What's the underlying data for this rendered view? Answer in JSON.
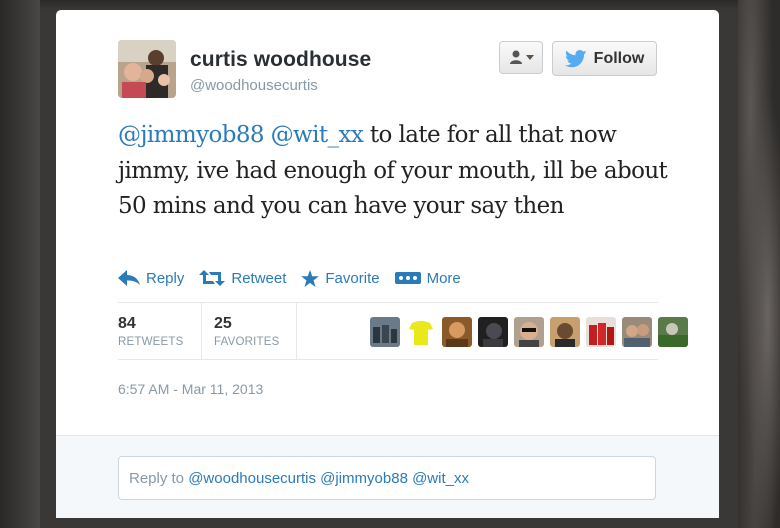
{
  "user": {
    "name": "curtis woodhouse",
    "handle": "@woodhousecurtis"
  },
  "buttons": {
    "follow_label": "Follow"
  },
  "tweet": {
    "mention1": "@jimmyob88",
    "mention2": "@wit_xx",
    "body": " to late for all that now jimmy, ive had enough of your mouth, ill be about 50 mins and you can have your say then"
  },
  "actions": {
    "reply": "Reply",
    "retweet": "Retweet",
    "favorite": "Favorite",
    "more": "More"
  },
  "stats": {
    "retweets_count": "84",
    "retweets_label": "RETWEETS",
    "favorites_count": "25",
    "favorites_label": "FAVORITES"
  },
  "timestamp": "6:57 AM - Mar 11, 2013",
  "reply_box": {
    "prefix": "Reply to ",
    "mentions": "@woodhousecurtis @jimmyob88 @wit_xx"
  },
  "colors": {
    "link": "#2b7bb9",
    "muted": "#8899a6",
    "twitter_blue": "#55acee"
  }
}
